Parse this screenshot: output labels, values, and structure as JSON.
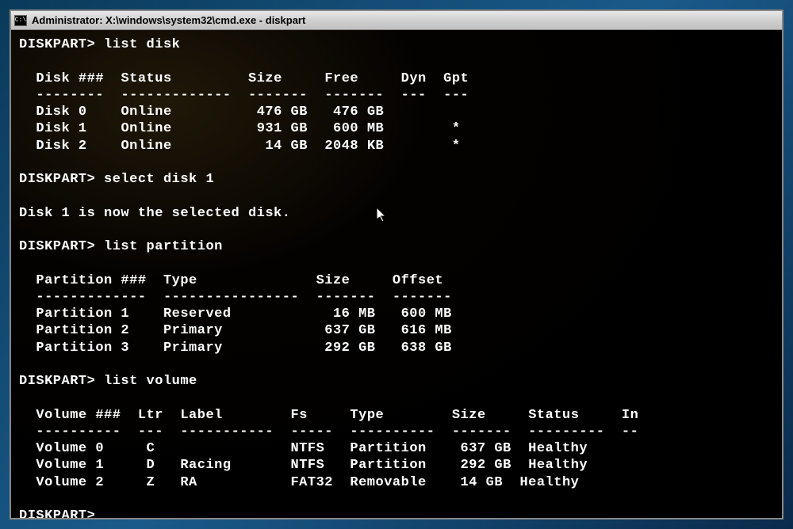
{
  "titlebar": {
    "icon_label": "C:\\",
    "text": "Administrator: X:\\windows\\system32\\cmd.exe - diskpart"
  },
  "prompt": "DISKPART>",
  "commands": {
    "cmd1": "list disk",
    "cmd2": "select disk 1",
    "cmd3": "list partition",
    "cmd4": "list volume"
  },
  "messages": {
    "selected": "Disk 1 is now the selected disk."
  },
  "disk_table": {
    "hdr_disk": "Disk ###",
    "hdr_status": "Status",
    "hdr_size": "Size",
    "hdr_free": "Free",
    "hdr_dyn": "Dyn",
    "hdr_gpt": "Gpt",
    "sep1": "--------",
    "sep2": "-------------",
    "sep3": "-------",
    "sep4": "-------",
    "sep5": "---",
    "sep6": "---",
    "rows": [
      {
        "disk": "Disk 0",
        "status": "Online",
        "size": "476 GB",
        "free": "476 GB",
        "dyn": "",
        "gpt": ""
      },
      {
        "disk": "Disk 1",
        "status": "Online",
        "size": "931 GB",
        "free": "600 MB",
        "dyn": "",
        "gpt": "*"
      },
      {
        "disk": "Disk 2",
        "status": "Online",
        "size": " 14 GB",
        "free": "2048 KB",
        "dyn": "",
        "gpt": "*"
      }
    ]
  },
  "partition_table": {
    "hdr_part": "Partition ###",
    "hdr_type": "Type",
    "hdr_size": "Size",
    "hdr_offset": "Offset",
    "sep1": "-------------",
    "sep2": "----------------",
    "sep3": "-------",
    "sep4": "-------",
    "rows": [
      {
        "part": "Partition 1",
        "type": "Reserved",
        "size": " 16 MB",
        "offset": "600 MB"
      },
      {
        "part": "Partition 2",
        "type": "Primary",
        "size": "637 GB",
        "offset": "616 MB"
      },
      {
        "part": "Partition 3",
        "type": "Primary",
        "size": "292 GB",
        "offset": "638 GB"
      }
    ]
  },
  "volume_table": {
    "hdr_vol": "Volume ###",
    "hdr_ltr": "Ltr",
    "hdr_label": "Label",
    "hdr_fs": "Fs",
    "hdr_type": "Type",
    "hdr_size": "Size",
    "hdr_status": "Status",
    "hdr_info": "In",
    "sep1": "----------",
    "sep2": "---",
    "sep3": "-----------",
    "sep4": "-----",
    "sep5": "----------",
    "sep6": "-------",
    "sep7": "---------",
    "sep8": "--",
    "rows": [
      {
        "vol": "Volume 0",
        "ltr": "C",
        "label": "",
        "fs": "NTFS",
        "type": "Partition",
        "size": "637 GB",
        "status": "Healthy"
      },
      {
        "vol": "Volume 1",
        "ltr": "D",
        "label": "Racing",
        "fs": "NTFS",
        "type": "Partition",
        "size": "292 GB",
        "status": "Healthy"
      },
      {
        "vol": "Volume 2",
        "ltr": "Z",
        "label": "RA",
        "fs": "FAT32",
        "type": "Removable",
        "size": " 14 GB",
        "status": "Healthy"
      }
    ]
  }
}
